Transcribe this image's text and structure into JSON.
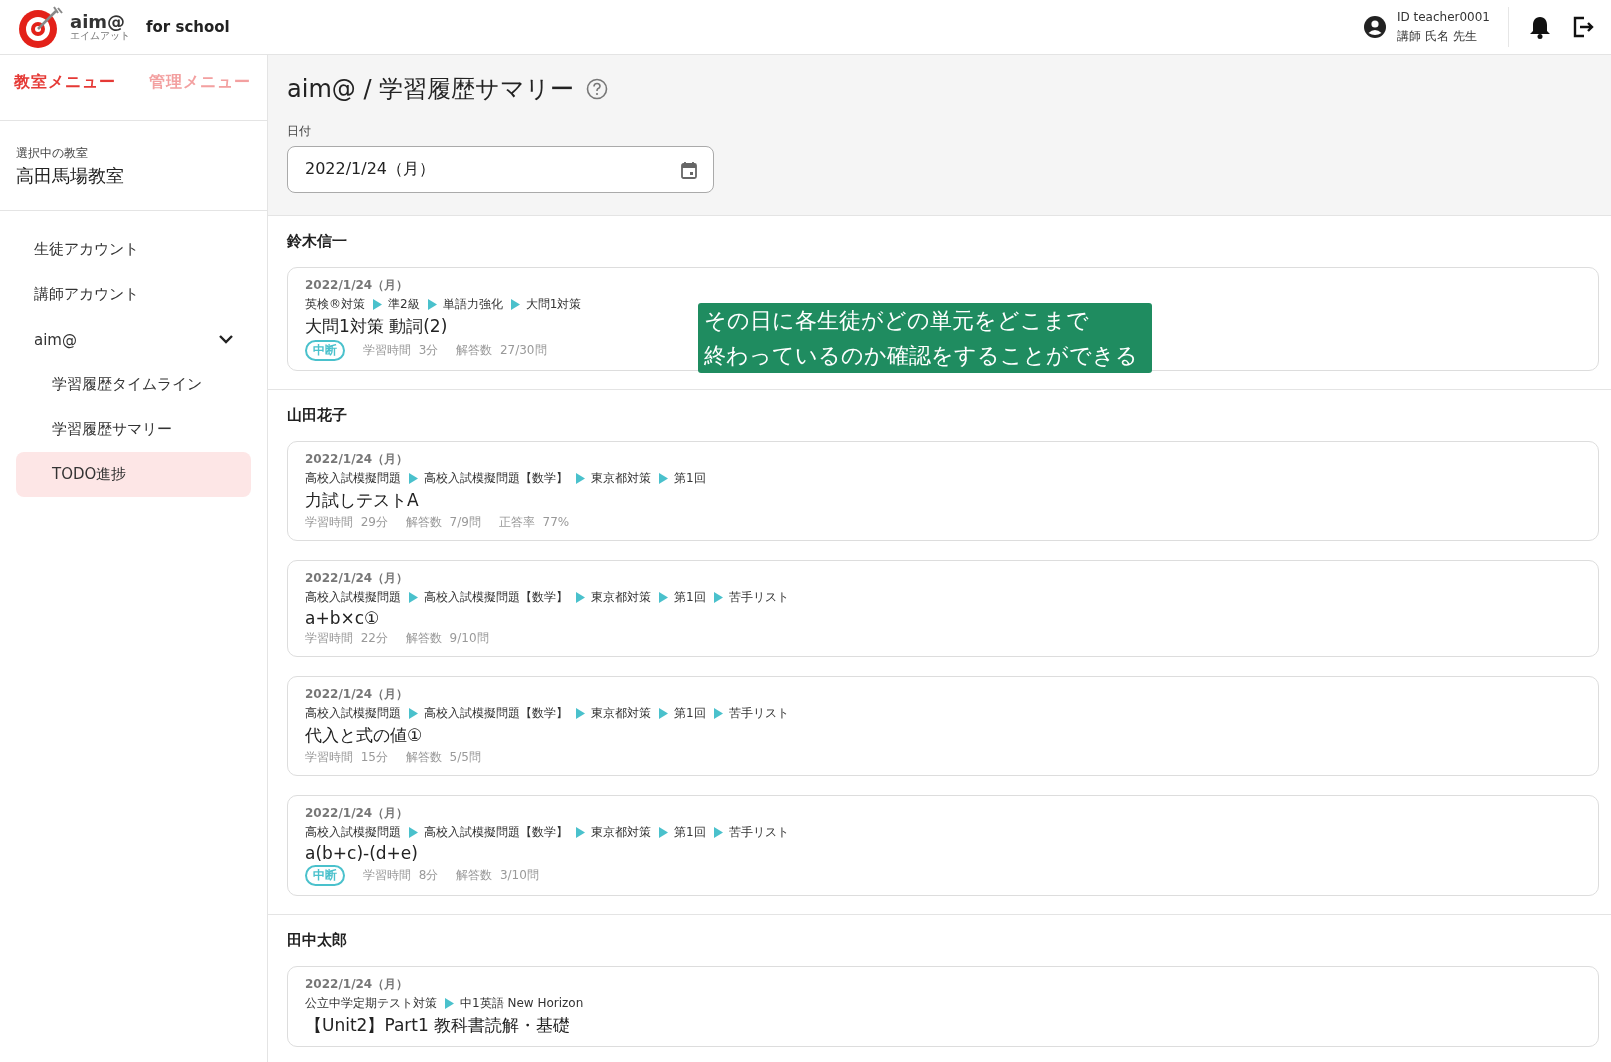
{
  "header": {
    "logo": {
      "name": "aim@",
      "reading": "エイムアット",
      "suffix": "for school"
    },
    "user": {
      "id": "ID teacher0001",
      "name": "講師 氏名 先生"
    }
  },
  "sidebar": {
    "tabs": [
      {
        "label": "教室メニュー",
        "selected": true
      },
      {
        "label": "管理メニュー",
        "selected": false
      }
    ],
    "classroom": {
      "label": "選択中の教室",
      "name": "高田馬場教室"
    },
    "items": [
      {
        "label": "生徒アカウント",
        "selected": false
      },
      {
        "label": "講師アカウント",
        "selected": false
      },
      {
        "label": "aim@",
        "selected": false,
        "expanded": true,
        "children": [
          {
            "label": "学習履歴タイムライン",
            "selected": false
          },
          {
            "label": "学習履歴サマリー",
            "selected": false
          },
          {
            "label": "TODO進捗",
            "selected": true
          }
        ]
      }
    ]
  },
  "page": {
    "title": "aim@ / 学習履歴サマリー",
    "date_field": {
      "label": "日付",
      "value": "2022/1/24（月）"
    }
  },
  "students": [
    {
      "name": "鈴木信一",
      "records": [
        {
          "date": "2022/1/24（月）",
          "path": [
            "英検®対策",
            "準2級",
            "単語力強化",
            "大問1対策"
          ],
          "title": "大問1対策 動詞(2)",
          "status": "中断",
          "stats": [
            {
              "label": "学習時間",
              "value": "3分"
            },
            {
              "label": "解答数",
              "value": "27/30問"
            }
          ]
        }
      ]
    },
    {
      "name": "山田花子",
      "records": [
        {
          "date": "2022/1/24（月）",
          "path": [
            "高校入試模擬問題",
            "高校入試模擬問題【数学】",
            "東京都対策",
            "第1回"
          ],
          "title": "力試しテストA",
          "stats": [
            {
              "label": "学習時間",
              "value": "29分"
            },
            {
              "label": "解答数",
              "value": "7/9問"
            },
            {
              "label": "正答率",
              "value": "77%"
            }
          ]
        },
        {
          "date": "2022/1/24（月）",
          "path": [
            "高校入試模擬問題",
            "高校入試模擬問題【数学】",
            "東京都対策",
            "第1回",
            "苦手リスト"
          ],
          "title": "a+b×c①",
          "stats": [
            {
              "label": "学習時間",
              "value": "22分"
            },
            {
              "label": "解答数",
              "value": "9/10問"
            }
          ]
        },
        {
          "date": "2022/1/24（月）",
          "path": [
            "高校入試模擬問題",
            "高校入試模擬問題【数学】",
            "東京都対策",
            "第1回",
            "苦手リスト"
          ],
          "title": "代入と式の値①",
          "stats": [
            {
              "label": "学習時間",
              "value": "15分"
            },
            {
              "label": "解答数",
              "value": "5/5問"
            }
          ]
        },
        {
          "date": "2022/1/24（月）",
          "path": [
            "高校入試模擬問題",
            "高校入試模擬問題【数学】",
            "東京都対策",
            "第1回",
            "苦手リスト"
          ],
          "title": "a(b+c)-(d+e)",
          "status": "中断",
          "stats": [
            {
              "label": "学習時間",
              "value": "8分"
            },
            {
              "label": "解答数",
              "value": "3/10問"
            }
          ]
        }
      ]
    },
    {
      "name": "田中太郎",
      "records": [
        {
          "date": "2022/1/24（月）",
          "path": [
            "公立中学定期テスト対策",
            "中1英語 New Horizon"
          ],
          "title": "【Unit2】Part1 教科書読解・基礎"
        }
      ]
    }
  ],
  "callout": {
    "lines": [
      "その日に各生徒がどの単元をどこまで",
      "終わっているのか確認をすることができる"
    ]
  }
}
